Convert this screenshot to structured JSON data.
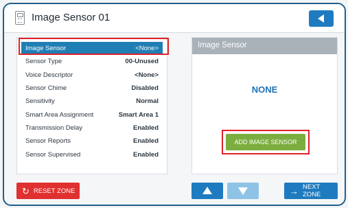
{
  "header": {
    "title": "Image Sensor 01",
    "device_icon": "sensor-device-icon",
    "back_icon": "left-triangle-icon"
  },
  "settings": [
    {
      "label": "Image Sensor",
      "value": "<None>",
      "selected": true
    },
    {
      "label": "Sensor Type",
      "value": "00-Unused"
    },
    {
      "label": "Voice Descriptor",
      "value": "<None>"
    },
    {
      "label": "Sensor Chime",
      "value": "Disabled"
    },
    {
      "label": "Sensitivity",
      "value": "Normal"
    },
    {
      "label": "Smart Area Assignment",
      "value": "Smart Area 1"
    },
    {
      "label": "Transmission Delay",
      "value": "Enabled"
    },
    {
      "label": "Sensor Reports",
      "value": "Enabled"
    },
    {
      "label": "Sensor Supervised",
      "value": "Enabled"
    }
  ],
  "panel": {
    "header": "Image Sensor",
    "value": "NONE",
    "add_button": "ADD IMAGE SENSOR"
  },
  "footer": {
    "reset_label": "RESET ZONE",
    "reset_icon": "reset-arrow-icon",
    "up_icon": "up-triangle-icon",
    "down_icon": "down-triangle-icon",
    "next_label": "NEXT ZONE",
    "next_icon": "right-arrow-icon"
  },
  "colors": {
    "accent_blue": "#1f7bbf",
    "selected_row": "#1f7fb5",
    "highlight_red": "#e0202a",
    "add_green": "#7cae3f",
    "reset_red": "#e0302f",
    "disabled_blue": "#8fc3e5",
    "panel_header_gray": "#a9b1b9"
  }
}
